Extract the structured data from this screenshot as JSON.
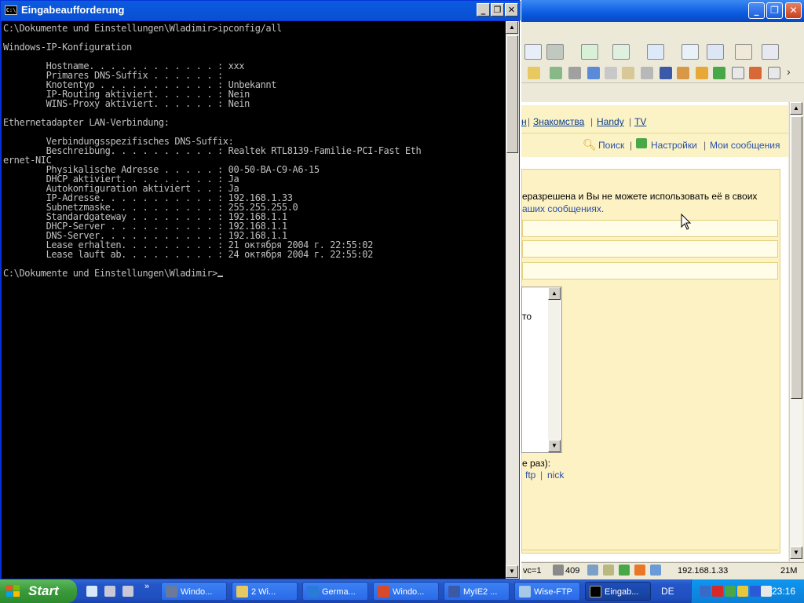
{
  "background_window": {
    "nav_links": [
      "Знакомства",
      "Handy",
      "TV"
    ],
    "nav_cut_link": "н",
    "nav2_links": [
      "Поиск",
      "Настройки",
      "Мои сообщения"
    ],
    "notice_line1": "еразрешена и Вы не можете использовать её в своих",
    "notice_line2": "аших сообщениях.",
    "textarea_text": "то",
    "below_textarea": "е раз):",
    "small_links": [
      "ftp",
      "nick"
    ],
    "status_fields": {
      "svc": "vc=1",
      "count": "409",
      "ip": "192.168.1.33",
      "mem": "21M"
    }
  },
  "console_window": {
    "title": "Eingabeaufforderung",
    "icon_label": "C:\\",
    "output": "C:\\Dokumente und Einstellungen\\Wladimir>ipconfig/all\n\nWindows-IP-Konfiguration\n\n        Hostname. . . . . . . . . . . . : xxx\n        Primares DNS-Suffix . . . . . . :\n        Knotentyp . . . . . . . . . . . : Unbekannt\n        IP-Routing aktiviert. . . . . . : Nein\n        WINS-Proxy aktiviert. . . . . . : Nein\n\nEthernetadapter LAN-Verbindung:\n\n        Verbindungsspezifisches DNS-Suffix:\n        Beschreibung. . . . . . . . . . : Realtek RTL8139-Familie-PCI-Fast Eth\nernet-NIC\n        Physikalische Adresse . . . . . : 00-50-BA-C9-A6-15\n        DHCP aktiviert. . . . . . . . . : Ja\n        Autokonfiguration aktiviert . . : Ja\n        IP-Adresse. . . . . . . . . . . : 192.168.1.33\n        Subnetzmaske. . . . . . . . . . : 255.255.255.0\n        Standardgateway . . . . . . . . : 192.168.1.1\n        DHCP-Server . . . . . . . . . . : 192.168.1.1\n        DNS-Server. . . . . . . . . . . : 192.168.1.1\n        Lease erhalten. . . . . . . . . : 21 октября 2004 г. 22:55:02\n        Lease lauft ab. . . . . . . . . : 24 октября 2004 г. 22:55:02\n\nC:\\Dokumente und Einstellungen\\Wladimir>"
  },
  "taskbar": {
    "start_label": "Start",
    "tasks": [
      {
        "label": "Windo...",
        "color": "#6a7a9a"
      },
      {
        "label": "2 Wi...",
        "color": "#e8c860"
      },
      {
        "label": "Germa...",
        "color": "#2a7ad8"
      },
      {
        "label": "Windo...",
        "color": "#d84a2a"
      },
      {
        "label": "MyIE2 ...",
        "color": "#3a5aa8"
      },
      {
        "label": "Wise-FTP",
        "color": "#a8c8e8"
      },
      {
        "label": "Eingab...",
        "color": "#000000"
      }
    ],
    "language": "DE",
    "clock": "23:16"
  }
}
